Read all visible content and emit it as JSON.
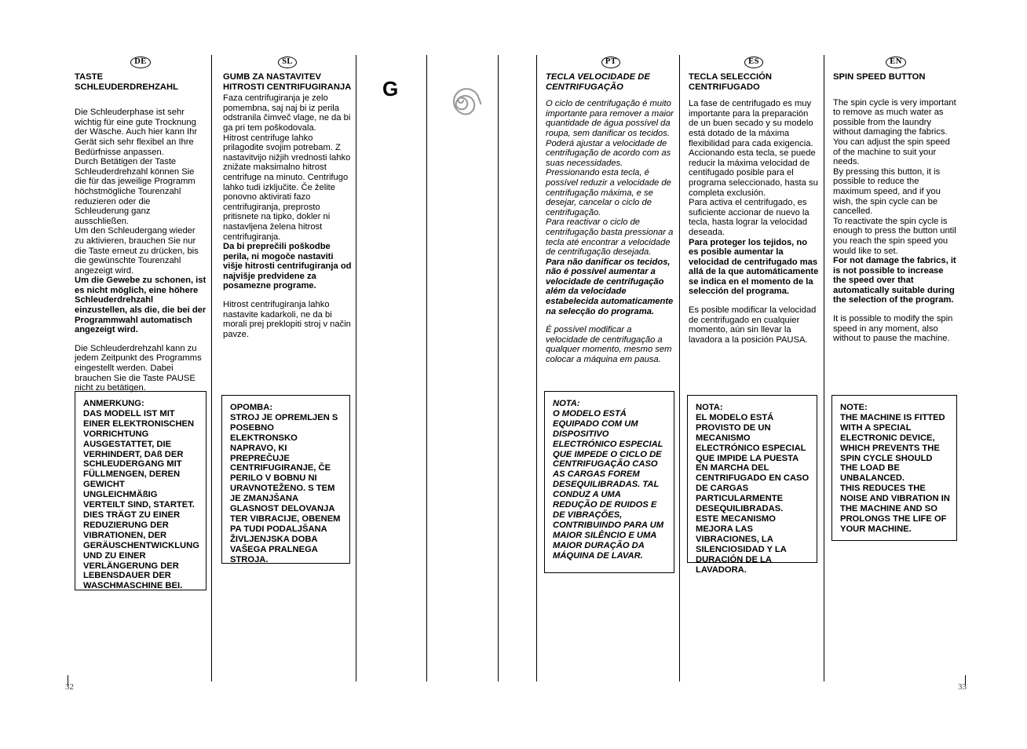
{
  "document": {
    "page_left": "32",
    "page_right": "33",
    "center_symbol_letter": "G",
    "center_symbol_icon": "spiral-spin-icon"
  },
  "columns": [
    {
      "lang_code": "DE",
      "heading": "TASTE SCHLEUDERDREHZAHL",
      "blocks": [
        {
          "style": "normal",
          "text": "Die Schleuderphase ist sehr wichtig für eine gute Trocknung der Wäsche. Auch hier kann Ihr Gerät sich sehr flexibel an Ihre Bedürfnisse anpassen.\nDurch Betätigen der Taste Schleuderdrehzahl können Sie die für das jeweilige Programm höchstmögliche Tourenzahl reduzieren oder die Schleuderung ganz ausschließen.\nUm den Schleudergang wieder zu aktivieren, brauchen Sie nur die Taste erneut zu drücken, bis die gewünschte Tourenzahl angezeigt wird."
        },
        {
          "style": "bold",
          "text": "Um die Gewebe zu schonen, ist es nicht möglich, eine höhere Schleuderdrehzahl einzustellen, als die, die bei der Programmwahl automatisch angezeigt wird."
        },
        {
          "style": "normal-gap",
          "text": "Die Schleuderdrehzahl kann zu jedem Zeitpunkt des Programms eingestellt werden. Dabei brauchen Sie die Taste PAUSE nicht zu betätigen."
        }
      ],
      "note": "ANMERKUNG:\nDAS MODELL IST MIT EINER ELEKTRONISCHEN VORRICHTUNG AUSGESTATTET, DIE VERHINDERT, DAß DER SCHLEUDERGANG MIT FÜLLMENGEN, DEREN GEWICHT UNGLEICHMÄßIG VERTEILT SIND, STARTET. DIES TRÄGT ZU EINER REDUZIERUNG DER VIBRATIONEN, DER GERÄUSCHENTWICKLUNG UND ZU EINER VERLÄNGERUNG DER LEBENSDAUER DER WASCHMASCHINE BEI."
    },
    {
      "lang_code": "SL",
      "heading": "GUMB ZA NASTAVITEV HITROSTI CENTRIFUGIRANJA",
      "blocks": [
        {
          "style": "normal-tight",
          "text": "Faza centrifugiranja je zelo pomembna, saj naj bi iz perila odstranila čimveč vlage, ne da bi ga pri tem poškodovala.\nHitrost centrifuge lahko prilagodite svojim potrebam. Z nastavitvijo nižjih vrednosti lahko znižate maksimalno hitrost centrifuge na minuto. Centrifugo lahko tudi izključite. Če želite ponovno aktivirati fazo centrifugiranja, preprosto pritisnete na tipko, dokler ni nastavljena želena hitrost centrifugiranja."
        },
        {
          "style": "bold",
          "text": "Da bi preprečili poškodbe perila, ni mogoče nastaviti višje hitrosti centrifugiranja od najvišje predvidene za posamezne programe."
        },
        {
          "style": "normal-gap",
          "text": "Hitrost centrifugiranja lahko nastavite kadarkoli, ne da bi morali prej preklopiti stroj v način pavze."
        }
      ],
      "note": "OPOMBA:\nSTROJ JE OPREMLJEN S POSEBNO ELEKTRONSKO NAPRAVO, KI PREPREČUJE CENTRIFUGIRANJE, ČE PERILO V BOBNU NI URAVNOTEŽENO. S TEM JE ZMANJŠANA GLASNOST DELOVANJA TER VIBRACIJE, OBENEM PA TUDI PODALJŠANA ŽIVLJENJSKA DOBA VAŠEGA PRALNEGA STROJA."
    },
    {
      "lang_code": "PT",
      "heading": "TECLA VELOCIDADE DE CENTRIFUGAÇÃO",
      "blocks": [
        {
          "style": "italic-gap",
          "text": "O ciclo de centrifugação é muito importante para remover a maior quantidade de água possível da roupa, sem danificar os tecidos. Poderá ajustar a velocidade de centrifugação de acordo com as suas necessidades.\nPressionando esta tecla, é possível reduzir a velocidade de centrifugação máxima, e se desejar, cancelar o ciclo de centrifugação.\nPara reactivar o ciclo de centrifugação basta pressionar a tecla até encontrar a velocidade de centrifugação desejada."
        },
        {
          "style": "italic-bold",
          "text": "Para não danificar os tecidos, não é possível aumentar a velocidade de centrifugação além da velocidade estabelecida automaticamente na selecção do programa."
        },
        {
          "style": "italic-gap2",
          "text": "É possível modificar a velocidade de centrifugação a qualquer momento, mesmo sem colocar a máquina em pausa."
        }
      ],
      "note": "NOTA:\nO MODELO ESTÁ EQUIPADO COM UM DISPOSITIVO ELECTRÓNICO ESPECIAL QUE IMPEDE O CICLO DE CENTRIFUGAÇÃO CASO AS CARGAS FOREM DESEQUILIBRADAS. TAL CONDUZ A UMA REDUÇÃO DE RUIDOS E DE VIBRAÇÕES, CONTRIBUINDO PARA UM MAIOR SILÊNCIO E UMA MAIOR DURAÇÃO DA MÁQUINA DE LAVAR."
    },
    {
      "lang_code": "ES",
      "heading": "TECLA SELECCIÓN CENTRIFUGADO",
      "blocks": [
        {
          "style": "normal",
          "text": "La fase de  centrifugado es muy importante para la preparación de un buen secado y su modelo está dotado de la máxima flexibilidad para cada exigencia. Accionando esta tecla, se puede reducir la máxima velocidad de centifugado posible para el programa seleccionado, hasta su completa exclusión.\nPara activa el centrifugado, es suficiente accionar de nuevo la tecla, hasta lograr la velocidad deseada."
        },
        {
          "style": "bold",
          "text": "Para proteger los tejidos, no es posible aumentar la velocidad de centrifugado mas allá de la que automáticamente se indica en el momento de la selección del programa."
        },
        {
          "style": "normal-gap",
          "text": "Es posible modificar la velocidad de centrifugado en cualquier momento, aún sin llevar la lavadora a la posición PAUSA."
        }
      ],
      "note": "NOTA:\nEL MODELO ESTÁ PROVISTO DE UN MECANISMO ELECTRÓNICO ESPECIAL QUE IMPIDE LA PUESTA EN MARCHA DEL CENTRIFUGADO EN CASO DE CARGAS PARTICULARMENTE DESEQUILIBRADAS.\nESTE MECANISMO MEJORA LAS VIBRACIONES, LA SILENCIOSIDAD Y LA DURACIÓN DE LA LAVADORA."
    },
    {
      "lang_code": "EN",
      "heading": "SPIN SPEED BUTTON",
      "blocks": [
        {
          "style": "normal-gap",
          "text": "The spin cycle is very important to remove as much water as possible from the laundry without damaging the fabrics. You can adjust the spin speed of the machine to suit your needs.\nBy pressing this button, it is possible to reduce the maximum speed, and if you wish, the spin cycle can be cancelled.\nTo reactivate the spin cycle is enough to press the button until you reach the spin speed you would like to set."
        },
        {
          "style": "bold",
          "text": "For not damage the fabrics, it is not possible to increase the speed over that automatically suitable during the selection of the program."
        },
        {
          "style": "normal-gap",
          "text": "It is possible to modify the spin speed in any moment, also without to pause the machine."
        }
      ],
      "note": "NOTE:\nTHE MACHINE IS FITTED WITH A SPECIAL ELECTRONIC DEVICE, WHICH PREVENTS THE SPIN CYCLE SHOULD THE LOAD BE UNBALANCED.\nTHIS REDUCES THE NOISE AND VIBRATION IN THE MACHINE AND SO PROLONGS THE LIFE OF YOUR MACHINE."
    }
  ]
}
